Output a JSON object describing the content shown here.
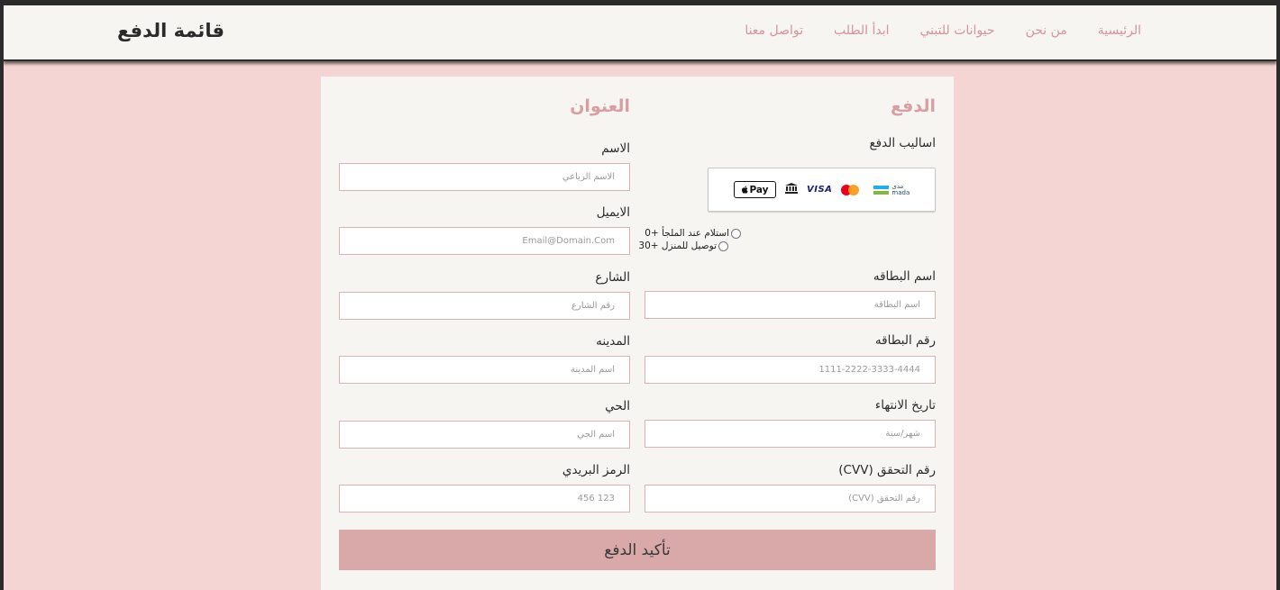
{
  "navbar": {
    "brand": "قائمة الدفع",
    "links": [
      "الرئيسية",
      "من نحن",
      "حيوانات للتبني",
      "ابدأ الطلب",
      "تواصل معنا"
    ]
  },
  "payment": {
    "title": "الدفع",
    "methods_label": "اساليب الدفع",
    "methods": {
      "applepay_text": "Pay",
      "visa_text": "VISA",
      "mada_text_ar": "مدى",
      "mada_text_en": "mada"
    },
    "delivery_options": [
      {
        "label": "استلام عند الملجأ +0"
      },
      {
        "label": "توصيل للمنزل +30"
      }
    ],
    "card_name_label": "اسم البطاقه",
    "card_name_placeholder": "اسم البطاقة",
    "card_number_label": "رقم البطاقه",
    "card_number_placeholder": "1111-2222-3333-4444",
    "expiry_label": "تاريخ الانتهاء",
    "expiry_placeholder": "شهر/سنة",
    "cvv_label": "رقم التحقق (CVV)",
    "cvv_placeholder": "رقم التحقق (CVV)"
  },
  "address": {
    "title": "العنوان",
    "name_label": "الاسم",
    "name_placeholder": "الاسم الرباعي",
    "email_label": "الايميل",
    "email_placeholder": "Email@Domain.Com",
    "street_label": "الشارع",
    "street_placeholder": "رقم الشارع",
    "city_label": "المدينه",
    "city_placeholder": "اسم المدينة",
    "district_label": "الحي",
    "district_placeholder": "اسم الحي",
    "zip_label": "الرمز البريدي",
    "zip_placeholder": "123 456"
  },
  "submit_label": "تأكيد الدفع",
  "colors": {
    "page_bg": "#f5d5d3",
    "card_bg": "#f6f5f1",
    "accent": "#d89ea2",
    "button": "#d9a8a9"
  }
}
